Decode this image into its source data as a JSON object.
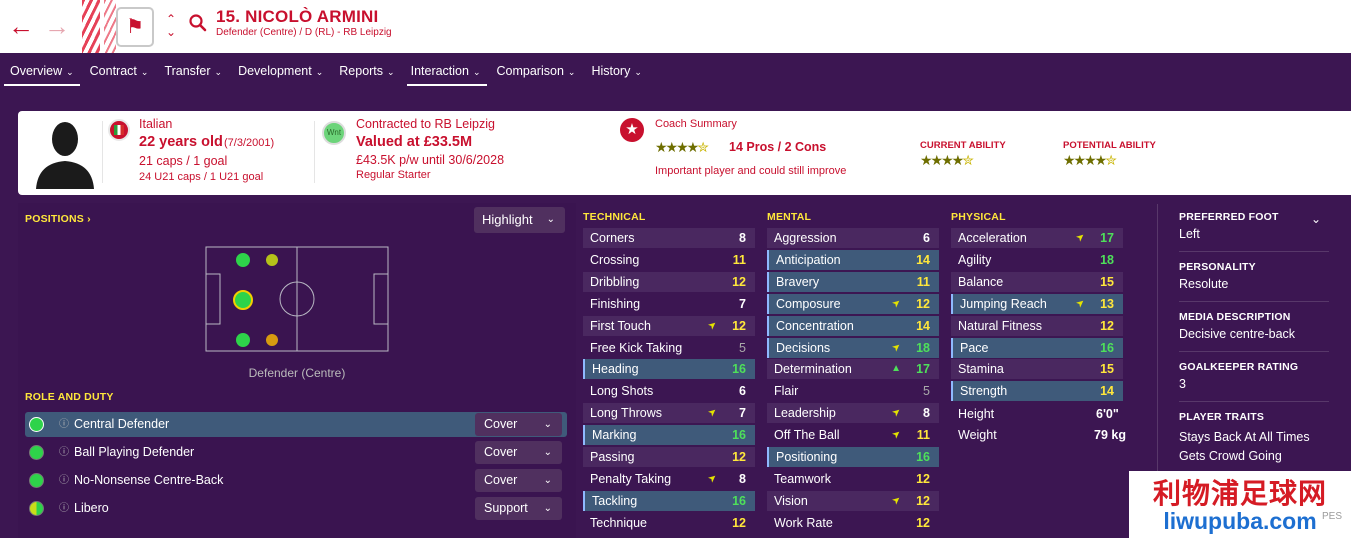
{
  "header": {
    "player_title": "15. NICOLÒ ARMINI",
    "player_sub": "Defender (Centre) / D (RL) - RB Leipzig",
    "back_icon": "arrow-left-icon",
    "forward_icon": "arrow-right-icon",
    "search_icon": "search-icon"
  },
  "tabs": [
    {
      "label": "Overview"
    },
    {
      "label": "Contract"
    },
    {
      "label": "Transfer"
    },
    {
      "label": "Development"
    },
    {
      "label": "Reports"
    },
    {
      "label": "Interaction"
    },
    {
      "label": "Comparison"
    },
    {
      "label": "History"
    }
  ],
  "card": {
    "nationality": "Italian",
    "age": "22 years old",
    "dob": "(7/3/2001)",
    "caps": "21 caps / 1 goal",
    "u21": "24 U21 caps / 1 U21 goal",
    "wnt": "Wnt",
    "contract_club": "Contracted to RB Leipzig",
    "valued": "Valued at £33.5M",
    "wage": "£43.5K p/w until 30/6/2028",
    "status": "Regular Starter",
    "coach_summary_label": "Coach Summary",
    "coach_stars": 4.5,
    "pros_cons": "14 Pros / 2 Cons",
    "coach_note": "Important player and could still improve",
    "ca_label": "CURRENT ABILITY",
    "ca_stars": 4.5,
    "pa_label": "POTENTIAL ABILITY",
    "pa_stars": 4.5
  },
  "positions": {
    "label": "POSITIONS",
    "highlight_label": "Highlight",
    "position_caption": "Defender (Centre)"
  },
  "roles": {
    "label": "ROLE AND DUTY",
    "items": [
      {
        "name": "Central Defender",
        "duty": "Cover",
        "selected": true
      },
      {
        "name": "Ball Playing Defender",
        "duty": "Cover",
        "selected": false
      },
      {
        "name": "No-Nonsense Centre-Back",
        "duty": "Cover",
        "selected": false
      },
      {
        "name": "Libero",
        "duty": "Support",
        "selected": false
      }
    ]
  },
  "technical": {
    "label": "TECHNICAL",
    "rows": [
      {
        "name": "Corners",
        "value": "8"
      },
      {
        "name": "Crossing",
        "value": "11"
      },
      {
        "name": "Dribbling",
        "value": "12"
      },
      {
        "name": "Finishing",
        "value": "7"
      },
      {
        "name": "First Touch",
        "value": "12",
        "arrow": "up-yellow"
      },
      {
        "name": "Free Kick Taking",
        "value": "5"
      },
      {
        "name": "Heading",
        "value": "16",
        "hl": true
      },
      {
        "name": "Long Shots",
        "value": "6"
      },
      {
        "name": "Long Throws",
        "value": "7",
        "arrow": "up-yellow"
      },
      {
        "name": "Marking",
        "value": "16",
        "hl": true
      },
      {
        "name": "Passing",
        "value": "12"
      },
      {
        "name": "Penalty Taking",
        "value": "8",
        "arrow": "up-yellow"
      },
      {
        "name": "Tackling",
        "value": "16",
        "hl": true
      },
      {
        "name": "Technique",
        "value": "12"
      }
    ]
  },
  "mental": {
    "label": "MENTAL",
    "rows": [
      {
        "name": "Aggression",
        "value": "6"
      },
      {
        "name": "Anticipation",
        "value": "14",
        "hl": true
      },
      {
        "name": "Bravery",
        "value": "11",
        "hl": true
      },
      {
        "name": "Composure",
        "value": "12",
        "arrow": "up-yellow",
        "hl": true
      },
      {
        "name": "Concentration",
        "value": "14",
        "hl": true
      },
      {
        "name": "Decisions",
        "value": "18",
        "arrow": "up-yellow",
        "hl": true
      },
      {
        "name": "Determination",
        "value": "17",
        "arrow": "up-green"
      },
      {
        "name": "Flair",
        "value": "5"
      },
      {
        "name": "Leadership",
        "value": "8",
        "arrow": "up-yellow"
      },
      {
        "name": "Off The Ball",
        "value": "11",
        "arrow": "up-yellow"
      },
      {
        "name": "Positioning",
        "value": "16",
        "hl": true
      },
      {
        "name": "Teamwork",
        "value": "12"
      },
      {
        "name": "Vision",
        "value": "12",
        "arrow": "up-yellow"
      },
      {
        "name": "Work Rate",
        "value": "12"
      }
    ]
  },
  "physical": {
    "label": "PHYSICAL",
    "rows": [
      {
        "name": "Acceleration",
        "value": "17",
        "arrow": "up-yellow"
      },
      {
        "name": "Agility",
        "value": "18"
      },
      {
        "name": "Balance",
        "value": "15"
      },
      {
        "name": "Jumping Reach",
        "value": "13",
        "arrow": "up-yellow",
        "hl": true
      },
      {
        "name": "Natural Fitness",
        "value": "12"
      },
      {
        "name": "Pace",
        "value": "16",
        "hl": true
      },
      {
        "name": "Stamina",
        "value": "15"
      },
      {
        "name": "Strength",
        "value": "14",
        "hl": true
      }
    ],
    "height_label": "Height",
    "height_value": "6'0\"",
    "weight_label": "Weight",
    "weight_value": "79 kg"
  },
  "info": {
    "foot_label": "PREFERRED FOOT",
    "foot_value": "Left",
    "personality_label": "PERSONALITY",
    "personality_value": "Resolute",
    "media_label": "MEDIA DESCRIPTION",
    "media_value": "Decisive centre-back",
    "gk_label": "GOALKEEPER RATING",
    "gk_value": "3",
    "traits_label": "PLAYER TRAITS",
    "traits": [
      "Stays Back At All Times",
      "Gets Crowd Going"
    ]
  },
  "watermark": {
    "line1": "利物浦足球网",
    "line2": "liwupuba.com",
    "corner": "PES"
  }
}
